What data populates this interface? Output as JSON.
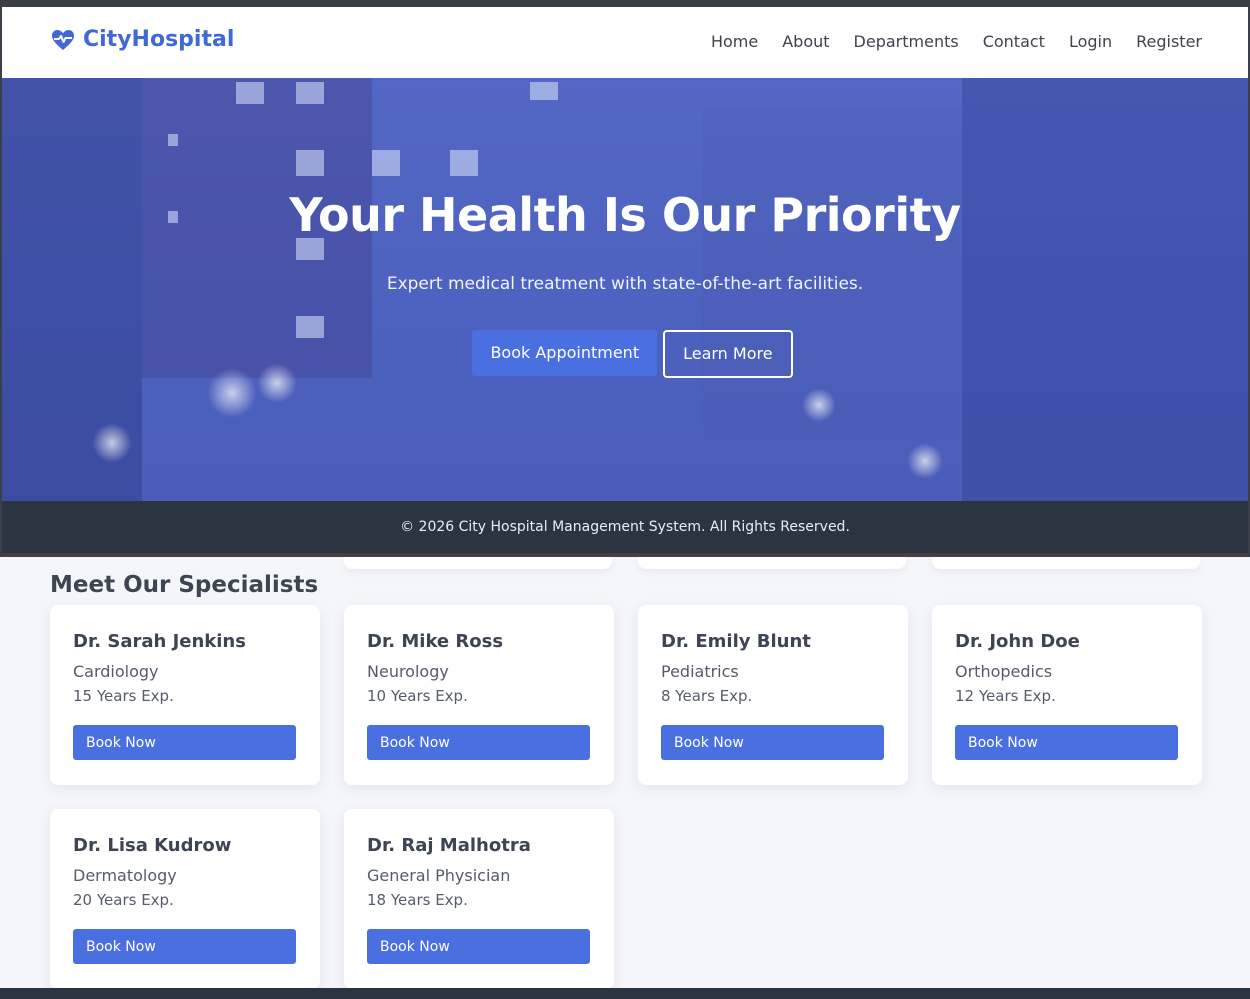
{
  "brand": {
    "name": "CityHospital",
    "icon": "heart-pulse-icon",
    "color": "#4169d6"
  },
  "nav": {
    "items": [
      "Home",
      "About",
      "Departments",
      "Contact",
      "Login",
      "Register"
    ]
  },
  "hero": {
    "title": "Your Health Is Our Priority",
    "subtitle": "Expert medical treatment with state-of-the-art facilities.",
    "primary_button": "Book Appointment",
    "secondary_button": "Learn More"
  },
  "footer": {
    "text": "© 2026 City Hospital Management System. All Rights Reserved."
  },
  "specialists": {
    "title": "Meet Our Specialists",
    "doctors": [
      {
        "name": "Dr. Sarah Jenkins",
        "department": "Cardiology",
        "experience": "15 Years Exp.",
        "button": "Book Now"
      },
      {
        "name": "Dr. Mike Ross",
        "department": "Neurology",
        "experience": "10 Years Exp.",
        "button": "Book Now"
      },
      {
        "name": "Dr. Emily Blunt",
        "department": "Pediatrics",
        "experience": "8 Years Exp.",
        "button": "Book Now"
      },
      {
        "name": "Dr. John Doe",
        "department": "Orthopedics",
        "experience": "12 Years Exp.",
        "button": "Book Now"
      },
      {
        "name": "Dr. Lisa Kudrow",
        "department": "Dermatology",
        "experience": "20 Years Exp.",
        "button": "Book Now"
      },
      {
        "name": "Dr. Raj Malhotra",
        "department": "General Physician",
        "experience": "18 Years Exp.",
        "button": "Book Now"
      }
    ]
  },
  "colors": {
    "primary": "#4a6fe0",
    "dark": "#2b3542",
    "hero_overlay": "#5467c4"
  }
}
